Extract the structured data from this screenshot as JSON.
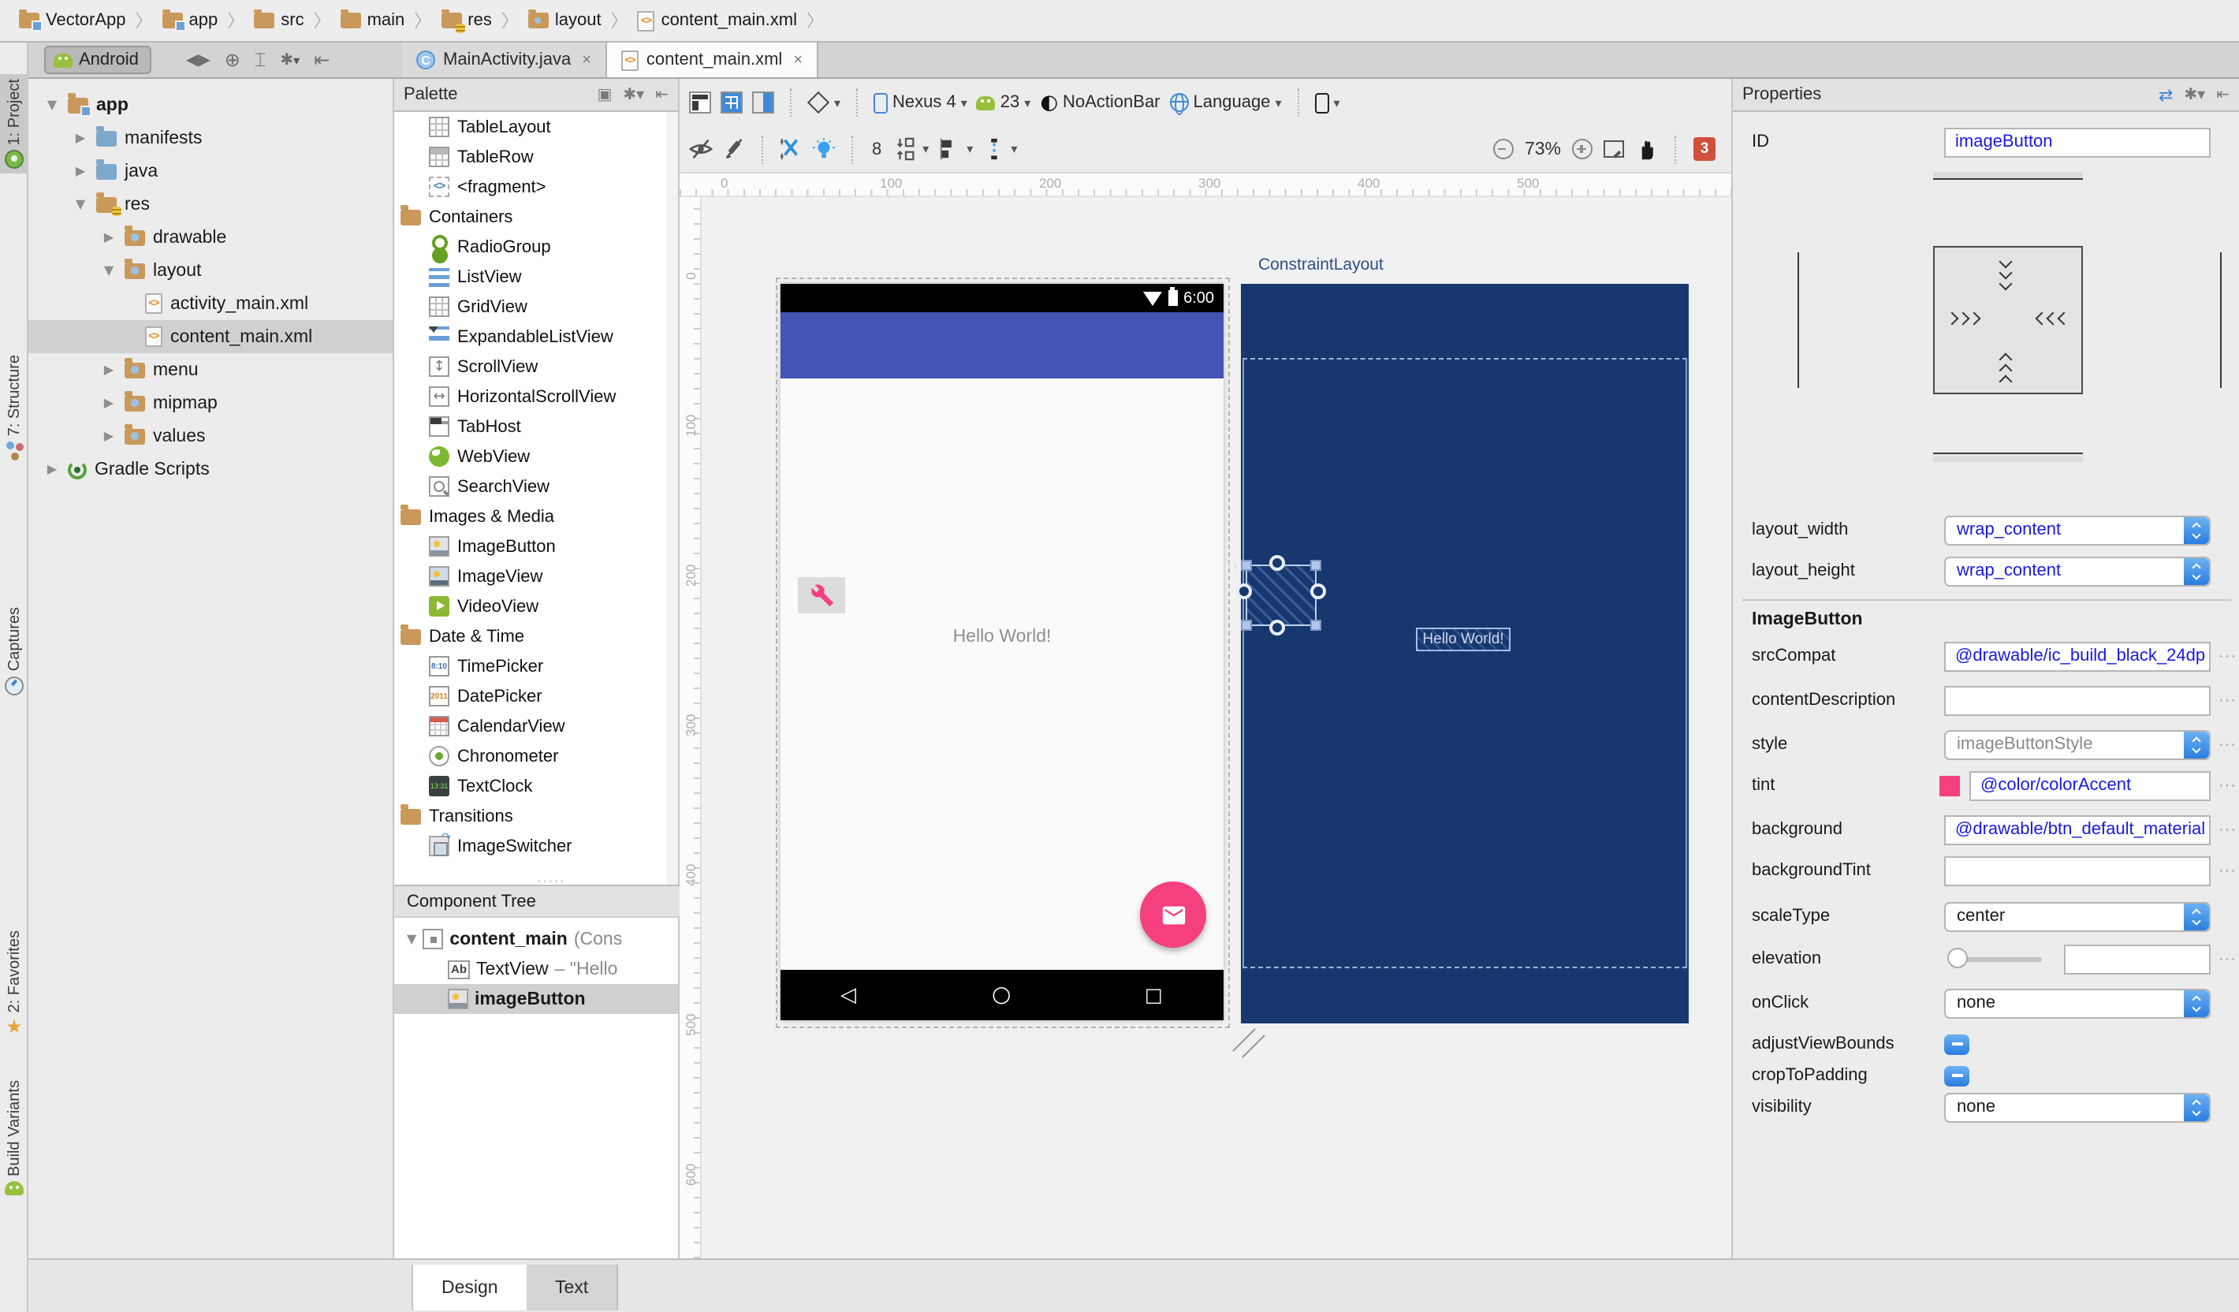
{
  "breadcrumb": {
    "items": [
      {
        "label": "VectorApp"
      },
      {
        "label": "app"
      },
      {
        "label": "src"
      },
      {
        "label": "main"
      },
      {
        "label": "res"
      },
      {
        "label": "layout"
      },
      {
        "label": "content_main.xml"
      }
    ]
  },
  "tool_strip": {
    "top": [
      {
        "label": "1: Project"
      },
      {
        "label": "7: Structure"
      },
      {
        "label": "Captures"
      }
    ],
    "bottom": [
      {
        "label": "2: Favorites"
      },
      {
        "label": "Build Variants"
      }
    ]
  },
  "project_toolbar": {
    "view_label": "Android"
  },
  "editor_tabs": [
    {
      "label": "MainActivity.java",
      "close": "×"
    },
    {
      "label": "content_main.xml",
      "close": "×"
    }
  ],
  "project_tree": {
    "items": [
      {
        "label": "app"
      },
      {
        "label": "manifests"
      },
      {
        "label": "java"
      },
      {
        "label": "res"
      },
      {
        "label": "drawable"
      },
      {
        "label": "layout"
      },
      {
        "label": "activity_main.xml"
      },
      {
        "label": "content_main.xml"
      },
      {
        "label": "menu"
      },
      {
        "label": "mipmap"
      },
      {
        "label": "values"
      },
      {
        "label": "Gradle Scripts"
      }
    ]
  },
  "palette": {
    "title": "Palette",
    "items": [
      {
        "label": "TableLayout"
      },
      {
        "label": "TableRow"
      },
      {
        "label": "<fragment>"
      },
      {
        "label": "Containers"
      },
      {
        "label": "RadioGroup"
      },
      {
        "label": "ListView"
      },
      {
        "label": "GridView"
      },
      {
        "label": "ExpandableListView"
      },
      {
        "label": "ScrollView"
      },
      {
        "label": "HorizontalScrollView"
      },
      {
        "label": "TabHost"
      },
      {
        "label": "WebView"
      },
      {
        "label": "SearchView"
      },
      {
        "label": "Images & Media"
      },
      {
        "label": "ImageButton"
      },
      {
        "label": "ImageView"
      },
      {
        "label": "VideoView"
      },
      {
        "label": "Date & Time"
      },
      {
        "label": "TimePicker"
      },
      {
        "label": "DatePicker"
      },
      {
        "label": "CalendarView"
      },
      {
        "label": "Chronometer"
      },
      {
        "label": "TextClock"
      },
      {
        "label": "Transitions"
      },
      {
        "label": "ImageSwitcher"
      }
    ]
  },
  "component_tree": {
    "title": "Component Tree",
    "rows": [
      {
        "label": "content_main",
        "suffix": "(Cons"
      },
      {
        "label": "TextView",
        "suffix": "– \"Hello"
      },
      {
        "label": "imageButton",
        "suffix": ""
      }
    ]
  },
  "design_toolbar": {
    "device": "Nexus 4",
    "api_level": "23",
    "theme": "NoActionBar",
    "language": "Language",
    "default_margin": "8",
    "zoom_level": "73%",
    "error_count": "3"
  },
  "canvas": {
    "rulers": {
      "top": [
        "0",
        "100",
        "200",
        "300",
        "400",
        "500"
      ],
      "left": [
        "0",
        "100",
        "200",
        "300",
        "400",
        "500",
        "600"
      ]
    },
    "design_preview": {
      "status_time": "6:00",
      "hello_text": "Hello World!"
    },
    "blueprint": {
      "title": "ConstraintLayout",
      "hello_text": "Hello World!",
      "clipped_id_label": "l i"
    }
  },
  "properties": {
    "title": "Properties",
    "id": {
      "label": "ID",
      "value": "imageButton"
    },
    "layout_width": {
      "label": "layout_width",
      "value": "wrap_content"
    },
    "layout_height": {
      "label": "layout_height",
      "value": "wrap_content"
    },
    "section_title": "ImageButton",
    "srcCompat": {
      "label": "srcCompat",
      "value": "@drawable/ic_build_black_24dp"
    },
    "contentDescription": {
      "label": "contentDescription",
      "value": ""
    },
    "style": {
      "label": "style",
      "value": "imageButtonStyle"
    },
    "tint": {
      "label": "tint",
      "value": "@color/colorAccent",
      "swatch_color": "#f4407e"
    },
    "background": {
      "label": "background",
      "value": "@drawable/btn_default_material"
    },
    "backgroundTint": {
      "label": "backgroundTint",
      "value": ""
    },
    "scaleType": {
      "label": "scaleType",
      "value": "center"
    },
    "elevation": {
      "label": "elevation",
      "value": ""
    },
    "onClick": {
      "label": "onClick",
      "value": "none"
    },
    "adjustViewBounds": {
      "label": "adjustViewBounds"
    },
    "cropToPadding": {
      "label": "cropToPadding"
    },
    "visibility": {
      "label": "visibility",
      "value": "none"
    }
  },
  "bottom_tabs": [
    {
      "label": "Design"
    },
    {
      "label": "Text"
    }
  ],
  "colors": {
    "accent_pink": "#f4407e",
    "app_bar_indigo": "#4253b4",
    "blueprint_navy": "#17386e"
  }
}
